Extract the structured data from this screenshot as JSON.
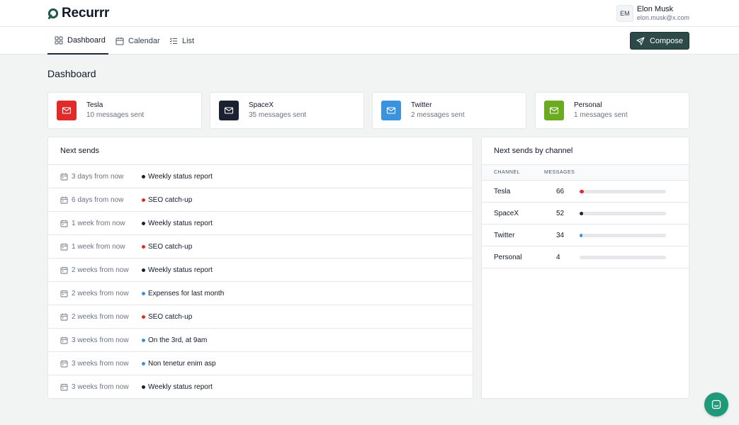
{
  "app": {
    "name": "Recurrr"
  },
  "user": {
    "initials": "EM",
    "name": "Elon Musk",
    "email": "elon.musk@x.com"
  },
  "nav": {
    "tabs": [
      {
        "label": "Dashboard",
        "icon": "dashboard-icon",
        "active": true
      },
      {
        "label": "Calendar",
        "icon": "calendar-icon",
        "active": false
      },
      {
        "label": "List",
        "icon": "list-icon",
        "active": false
      }
    ],
    "compose_label": "Compose"
  },
  "page": {
    "title": "Dashboard"
  },
  "channels": [
    {
      "name": "Tesla",
      "sent": "10 messages sent",
      "color": "#e02b2b"
    },
    {
      "name": "SpaceX",
      "sent": "35 messages sent",
      "color": "#1b2033"
    },
    {
      "name": "Twitter",
      "sent": "2 messages sent",
      "color": "#3b93de"
    },
    {
      "name": "Personal",
      "sent": "1 messages sent",
      "color": "#6aab1f"
    }
  ],
  "next_sends": {
    "title": "Next sends",
    "items": [
      {
        "when": "3 days from now",
        "title": "Weekly status report",
        "dot": "#1b2033"
      },
      {
        "when": "6 days from now",
        "title": "SEO catch-up",
        "dot": "#e02b2b"
      },
      {
        "when": "1 week from now",
        "title": "Weekly status report",
        "dot": "#1b2033"
      },
      {
        "when": "1 week from now",
        "title": "SEO catch-up",
        "dot": "#e02b2b"
      },
      {
        "when": "2 weeks from now",
        "title": "Weekly status report",
        "dot": "#1b2033"
      },
      {
        "when": "2 weeks from now",
        "title": "Expenses for last month",
        "dot": "#3b93de"
      },
      {
        "when": "2 weeks from now",
        "title": "SEO catch-up",
        "dot": "#e02b2b"
      },
      {
        "when": "3 weeks from now",
        "title": "On the 3rd, at 9am",
        "dot": "#3b93de"
      },
      {
        "when": "3 weeks from now",
        "title": "Non tenetur enim asp",
        "dot": "#3b93de"
      },
      {
        "when": "3 weeks from now",
        "title": "Weekly status report",
        "dot": "#1b2033"
      }
    ]
  },
  "by_channel": {
    "title": "Next sends by channel",
    "col_channel": "CHANNEL",
    "col_messages": "MESSAGES",
    "rows": [
      {
        "name": "Tesla",
        "count": "66",
        "fraction": 0.05,
        "color": "#e02b2b"
      },
      {
        "name": "SpaceX",
        "count": "52",
        "fraction": 0.04,
        "color": "#1b2033"
      },
      {
        "name": "Twitter",
        "count": "34",
        "fraction": 0.03,
        "color": "#3b93de"
      },
      {
        "name": "Personal",
        "count": "4",
        "fraction": 0.0,
        "color": "#6aab1f"
      }
    ]
  }
}
